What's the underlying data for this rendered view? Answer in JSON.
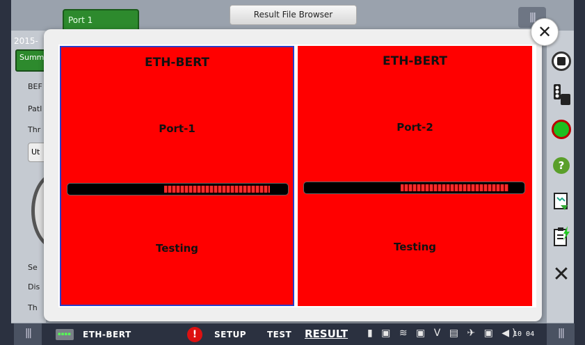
{
  "top_bar": {
    "port_tab": "Port 1",
    "result_file_browser": "Result File Browser",
    "grip": "|||"
  },
  "background": {
    "date": "2015-",
    "summary_tab": "Summ",
    "labels": [
      "BEF",
      "Patl",
      "Thr",
      "Se",
      "Dis",
      "Th"
    ],
    "button_ut": "Ut"
  },
  "dialog": {
    "close_icon": "close-icon",
    "panels": [
      {
        "title": "ETH-BERT",
        "port": "Port-1",
        "status": "Testing",
        "progress": 0.48,
        "bg_color": "#ff0000"
      },
      {
        "title": "ETH-BERT",
        "port": "Port-2",
        "status": "Testing",
        "progress": 0.49,
        "bg_color": "#ff0000"
      }
    ]
  },
  "right_rail": {
    "icons": [
      "stop-icon",
      "traffic-light-icon",
      "status-led-icon",
      "help-icon",
      "report-icon",
      "clipboard-icon",
      "close-icon"
    ],
    "help_label": "?"
  },
  "bottom_bar": {
    "grip": "|||",
    "module_label": "ETH-BERT",
    "alert_label": "!",
    "setup_label": "SETUP",
    "test_label": "TEST",
    "result_label": "RESULT",
    "tray_icons": "▮ ▣ ≋ ▣ V ▤ ✈ ▣ ◀)",
    "clock": "10 04"
  },
  "colors": {
    "panel_red": "#ff0000",
    "active_green": "#2d8a2d",
    "selection_blue": "#2a3dc8"
  }
}
